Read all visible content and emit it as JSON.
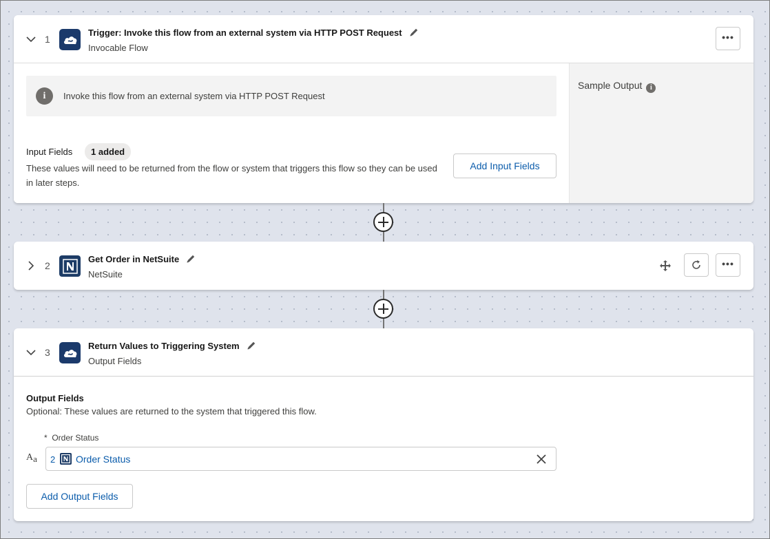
{
  "steps": [
    {
      "number": "1",
      "title": "Trigger: Invoke this flow from an external system via HTTP POST Request",
      "subtitle": "Invocable Flow",
      "info_text": "Invoke this flow from an external system via HTTP POST Request",
      "input_fields_label": "Input Fields",
      "input_fields_badge": "1 added",
      "input_fields_desc": "These values will need to be returned from the flow or system that triggers this flow so they can be used in later steps.",
      "add_input_label": "Add Input Fields",
      "sample_output_label": "Sample Output",
      "menu_label": "•••"
    },
    {
      "number": "2",
      "title": "Get Order in NetSuite",
      "subtitle": "NetSuite",
      "menu_label": "•••"
    },
    {
      "number": "3",
      "title": "Return Values to Triggering System",
      "subtitle": "Output Fields",
      "output_title": "Output Fields",
      "output_desc": "Optional: These values are returned to the system that triggered this flow.",
      "field_required_mark": "*",
      "field_label": "Order Status",
      "field_type_icon": "Aa",
      "pill_step": "2",
      "pill_value": "Order Status",
      "add_output_label": "Add Output Fields"
    }
  ],
  "icons": {
    "chevron_down": "chevron-down-icon",
    "chevron_right": "chevron-right-icon",
    "pencil": "pencil-icon",
    "info": "info-icon",
    "move": "move-icon",
    "refresh": "refresh-icon",
    "add": "add-step-icon",
    "close": "close-icon"
  },
  "colors": {
    "link": "#0b5cab",
    "app_icon_bg": "#1b3a6b",
    "canvas_bg": "#dfe3ec"
  }
}
